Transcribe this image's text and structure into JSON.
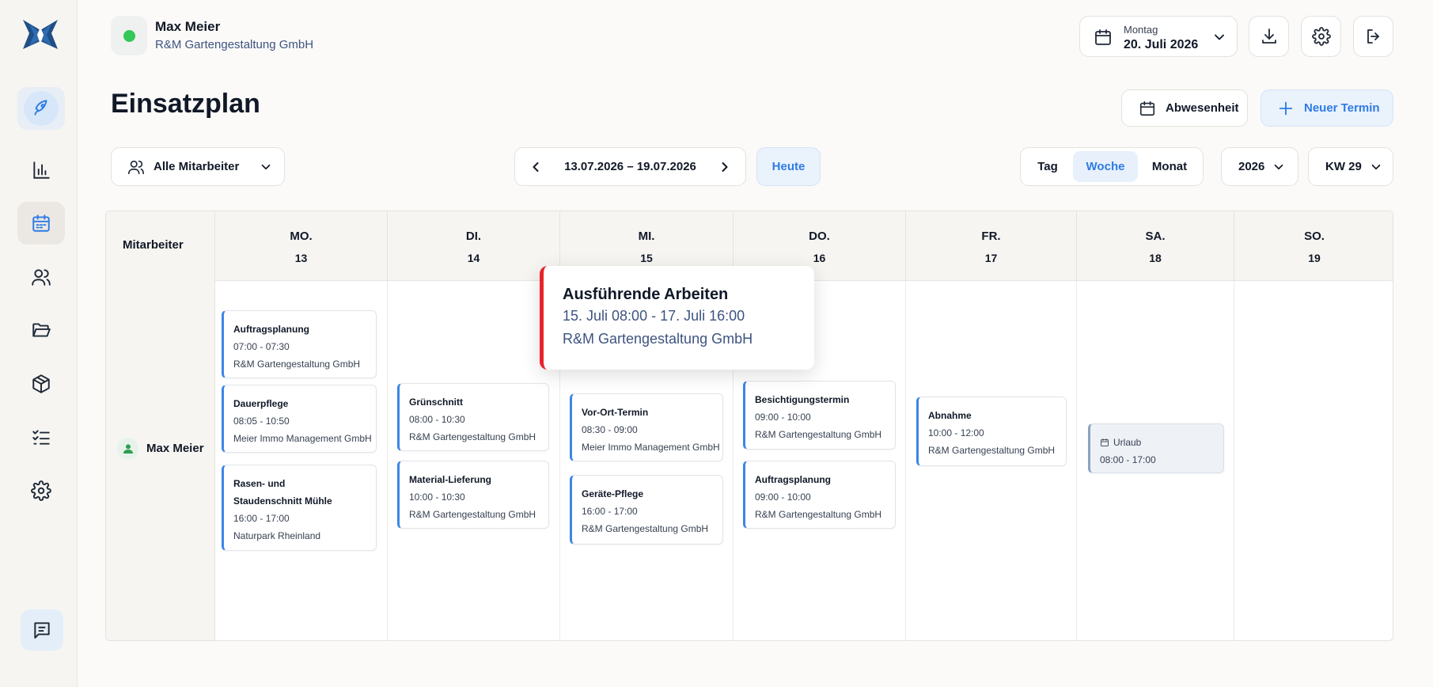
{
  "user": {
    "name": "Max Meier",
    "company": "R&M Gartengestaltung GmbH",
    "status_color": "#34c759"
  },
  "date_picker": {
    "weekday": "Montag",
    "date": "20. Juli 2026"
  },
  "page": {
    "title": "Einsatzplan"
  },
  "actions": {
    "absence_label": "Abwesenheit",
    "new_label": "Neuer Termin"
  },
  "toolbar": {
    "employee_filter": "Alle Mitarbeiter",
    "range": "13.07.2026 – 19.07.2026",
    "today": "Heute",
    "views": [
      "Tag",
      "Woche",
      "Monat"
    ],
    "active_view": "Woche",
    "year": "2026",
    "week": "KW 29"
  },
  "calendar": {
    "employee_header": "Mitarbeiter",
    "days": [
      {
        "name": "MO.",
        "date": "13"
      },
      {
        "name": "DI.",
        "date": "14"
      },
      {
        "name": "MI.",
        "date": "15"
      },
      {
        "name": "DO.",
        "date": "16"
      },
      {
        "name": "FR.",
        "date": "17"
      },
      {
        "name": "SA.",
        "date": "18"
      },
      {
        "name": "SO.",
        "date": "19"
      }
    ],
    "employee": "Max Meier",
    "events": [
      {
        "title": "Auftragsplanung",
        "time": "07:00 - 07:30",
        "client": "R&M Gartengestaltung GmbH"
      },
      {
        "title": "Dauerpflege",
        "time": "08:05 - 10:50",
        "client": "Meier Immo Management GmbH"
      },
      {
        "title": "Rasen- und Staudenschnitt Mühle",
        "time": "16:00 - 17:00",
        "client": "Naturpark Rheinland"
      },
      {
        "title": "Grünschnitt",
        "time": "08:00 - 10:30",
        "client": "R&M Gartengestaltung GmbH"
      },
      {
        "title": "Material-Lieferung",
        "time": "10:00 - 10:30",
        "client": "R&M Gartengestaltung GmbH"
      },
      {
        "title": "Vor-Ort-Termin",
        "time": "08:30 - 09:00",
        "client": "Meier Immo Management GmbH"
      },
      {
        "title": "Geräte-Pflege",
        "time": "16:00 - 17:00",
        "client": "R&M Gartengestaltung GmbH"
      },
      {
        "title": "Besichtigungstermin",
        "time": "09:00 - 10:00",
        "client": "R&M Gartengestaltung GmbH"
      },
      {
        "title": "Auftragsplanung",
        "time": "09:00 - 10:00",
        "client": "R&M Gartengestaltung GmbH"
      },
      {
        "title": "Abnahme",
        "time": "10:00 - 12:00",
        "client": "R&M Gartengestaltung GmbH"
      },
      {
        "title": "Urlaub",
        "time": "08:00 - 17:00"
      }
    ]
  },
  "popover": {
    "title": "Ausführende Arbeiten",
    "dates": "15. Juli 08:00 - 17. Juli 16:00",
    "client": "R&M Gartengestaltung GmbH",
    "accent": "#e8242b"
  },
  "icons": {
    "sidebar": [
      "rocket-icon",
      "bar-chart-icon",
      "calendar-icon",
      "users-icon",
      "folder-icon",
      "box-icon",
      "checklist-icon",
      "settings-icon",
      "chat-icon"
    ]
  }
}
